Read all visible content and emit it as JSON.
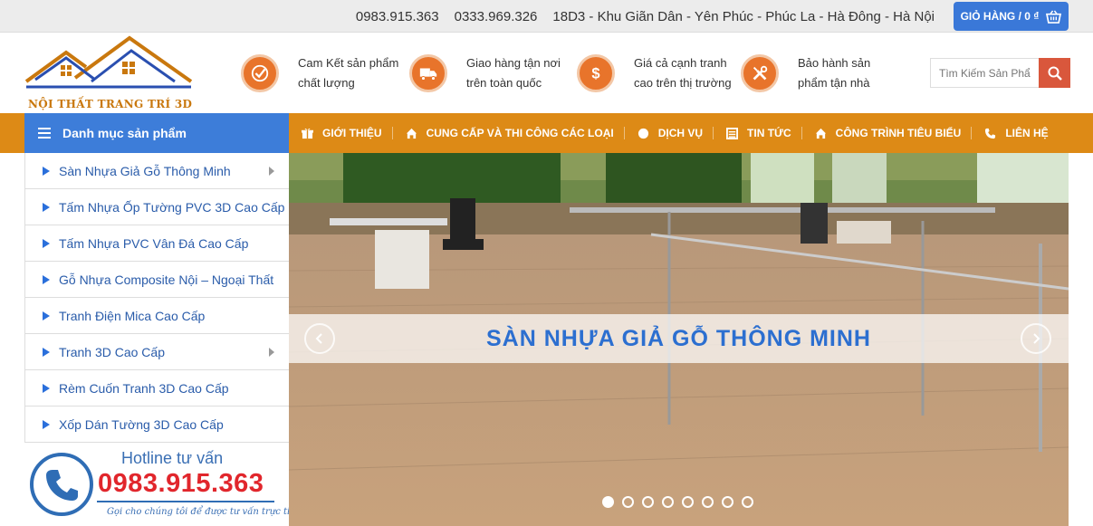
{
  "topbar": {
    "phone1": "0983.915.363",
    "phone2": "0333.969.326",
    "address": "18D3 - Khu Giãn Dân - Yên Phúc - Phúc La - Hà Đông - Hà Nội",
    "cart_label": "GIỎ HÀNG / 0 ₫"
  },
  "logo": {
    "text": "NỘI THẤT TRANG TRÍ 3D"
  },
  "features": [
    {
      "line1": "Cam Kết sản phẩm",
      "line2": "chất lượng",
      "icon": "check-icon"
    },
    {
      "line1": "Giao hàng tận nơi",
      "line2": "trên toàn quốc",
      "icon": "truck-icon"
    },
    {
      "line1": "Giá cả cạnh tranh",
      "line2": "cao trên thị trường",
      "icon": "dollar-icon"
    },
    {
      "line1": "Bảo hành sản",
      "line2": "phẩm tận nhà",
      "icon": "tools-icon"
    }
  ],
  "search": {
    "placeholder": "Tìm Kiếm Sản Phẩm"
  },
  "category_header": "Danh mục sản phẩm",
  "menu": [
    {
      "label": "GIỚI THIỆU",
      "icon": "gift-icon"
    },
    {
      "label": "CUNG CẤP VÀ THI CÔNG CÁC LOẠI",
      "icon": "building-icon"
    },
    {
      "label": "DỊCH VỤ",
      "icon": "circle-icon"
    },
    {
      "label": "TIN TỨC",
      "icon": "news-icon"
    },
    {
      "label": "CÔNG TRÌNH TIÊU BIỂU",
      "icon": "building-icon"
    },
    {
      "label": "LIÊN HỆ",
      "icon": "phone-icon"
    }
  ],
  "categories": [
    {
      "label": "Sàn Nhựa Giả Gỗ Thông Minh",
      "has_sub": true
    },
    {
      "label": "Tấm Nhựa Ốp Tường PVC 3D Cao Cấp",
      "has_sub": false
    },
    {
      "label": "Tấm Nhựa PVC Vân Đá Cao Cấp",
      "has_sub": false
    },
    {
      "label": "Gỗ Nhựa Composite Nội – Ngoại Thất",
      "has_sub": false
    },
    {
      "label": "Tranh Điện Mica Cao Cấp",
      "has_sub": false
    },
    {
      "label": "Tranh 3D Cao Cấp",
      "has_sub": true
    },
    {
      "label": "Rèm Cuốn Tranh 3D Cao Cấp",
      "has_sub": false
    },
    {
      "label": "Xốp Dán Tường 3D Cao Cấp",
      "has_sub": false
    }
  ],
  "hotline": {
    "title": "Hotline tư vấn",
    "number": "0983.915.363",
    "subtitle": "Gọi cho chúng tôi để được tư vấn trực tiếp"
  },
  "slider": {
    "caption": "SÀN NHỰA GIẢ GỖ THÔNG MINH",
    "slide_count": 8,
    "active_index": 0
  },
  "colors": {
    "nav_orange": "#dd8a16",
    "category_blue": "#3d7dd9",
    "feature_icon": "#e8742b",
    "hotline_red": "#e1262c"
  }
}
